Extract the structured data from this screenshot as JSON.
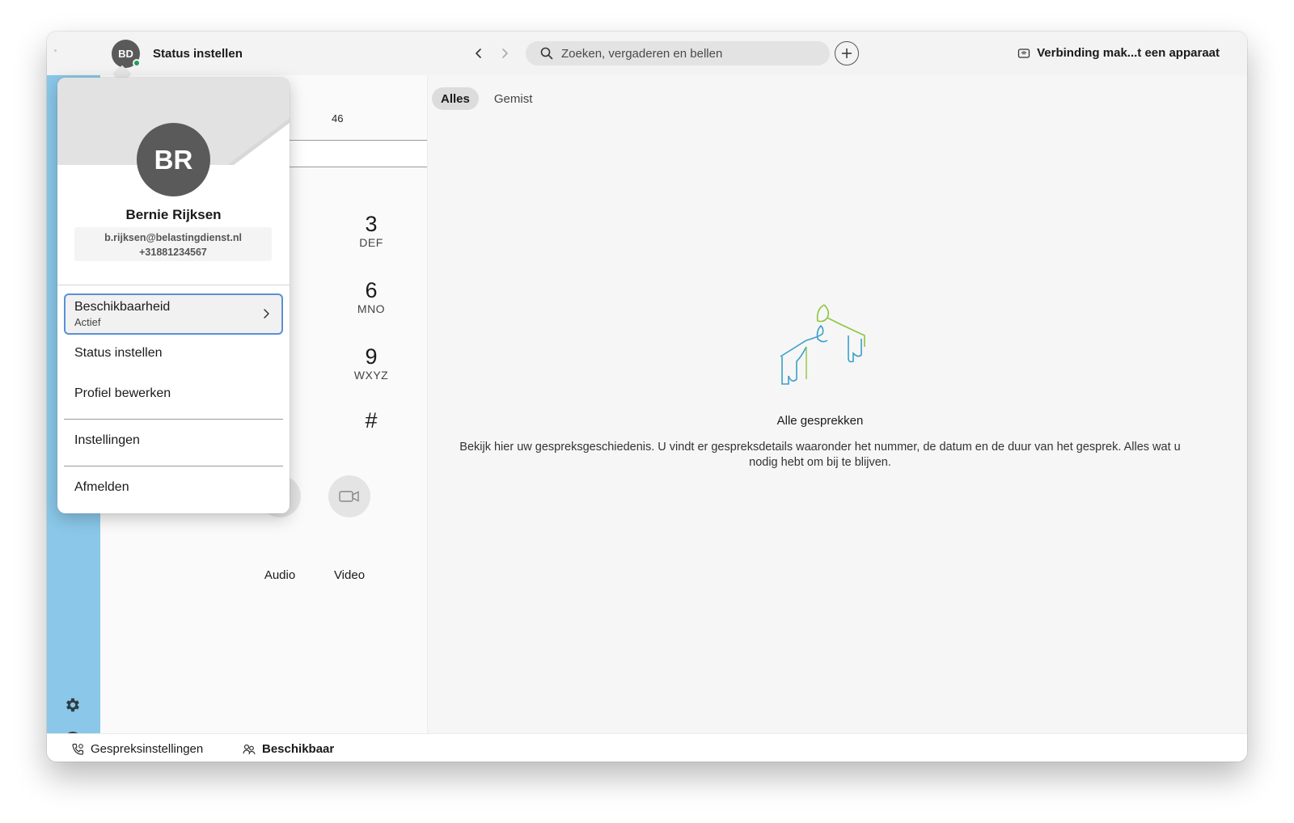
{
  "titlebar": {
    "avatar_initials": "BD",
    "status_title": "Status instellen",
    "search_placeholder": "Zoeken, vergaderen en bellen",
    "connect_label": "Verbinding mak...t een apparaat"
  },
  "dialer": {
    "number_fragment": "46",
    "keys": [
      {
        "num": "3",
        "letters": "DEF"
      },
      {
        "num": "6",
        "letters": "MNO"
      },
      {
        "num": "9",
        "letters": "WXYZ"
      },
      {
        "num": "#",
        "letters": ""
      }
    ],
    "audio_label": "Audio",
    "video_label": "Video"
  },
  "history": {
    "tabs": [
      {
        "label": "Alles",
        "active": true
      },
      {
        "label": "Gemist",
        "active": false
      }
    ],
    "empty_title": "Alle gesprekken",
    "empty_text": "Bekijk hier uw gespreksgeschiedenis. U vindt er gespreksdetails waaronder het nummer, de datum en de duur van het gesprek. Alles wat u nodig hebt om bij te blijven."
  },
  "bottombar": {
    "call_settings_label": "Gespreksinstellingen",
    "availability_label": "Beschikbaar"
  },
  "profile_popup": {
    "initials": "BR",
    "name": "Bernie Rijksen",
    "email": "b.rijksen@belastingdienst.nl",
    "phone": "+31881234567",
    "availability": {
      "label": "Beschikbaarheid",
      "value": "Actief"
    },
    "menu": {
      "status": "Status instellen",
      "edit_profile": "Profiel bewerken",
      "settings": "Instellingen",
      "logout": "Afmelden"
    }
  },
  "colors": {
    "rail": "#8ac7e8",
    "presence": "#1f9e5a",
    "selection_border": "#5b8fd8",
    "illustration_green": "#8cc63f",
    "illustration_blue": "#3aa0c8"
  },
  "icons": [
    "back-icon",
    "forward-icon",
    "search-icon",
    "plus-icon",
    "connect-device-icon",
    "call-icon",
    "gear-icon",
    "help-icon",
    "video-icon",
    "call-settings-icon",
    "availability-icon",
    "chevron-right-icon"
  ]
}
